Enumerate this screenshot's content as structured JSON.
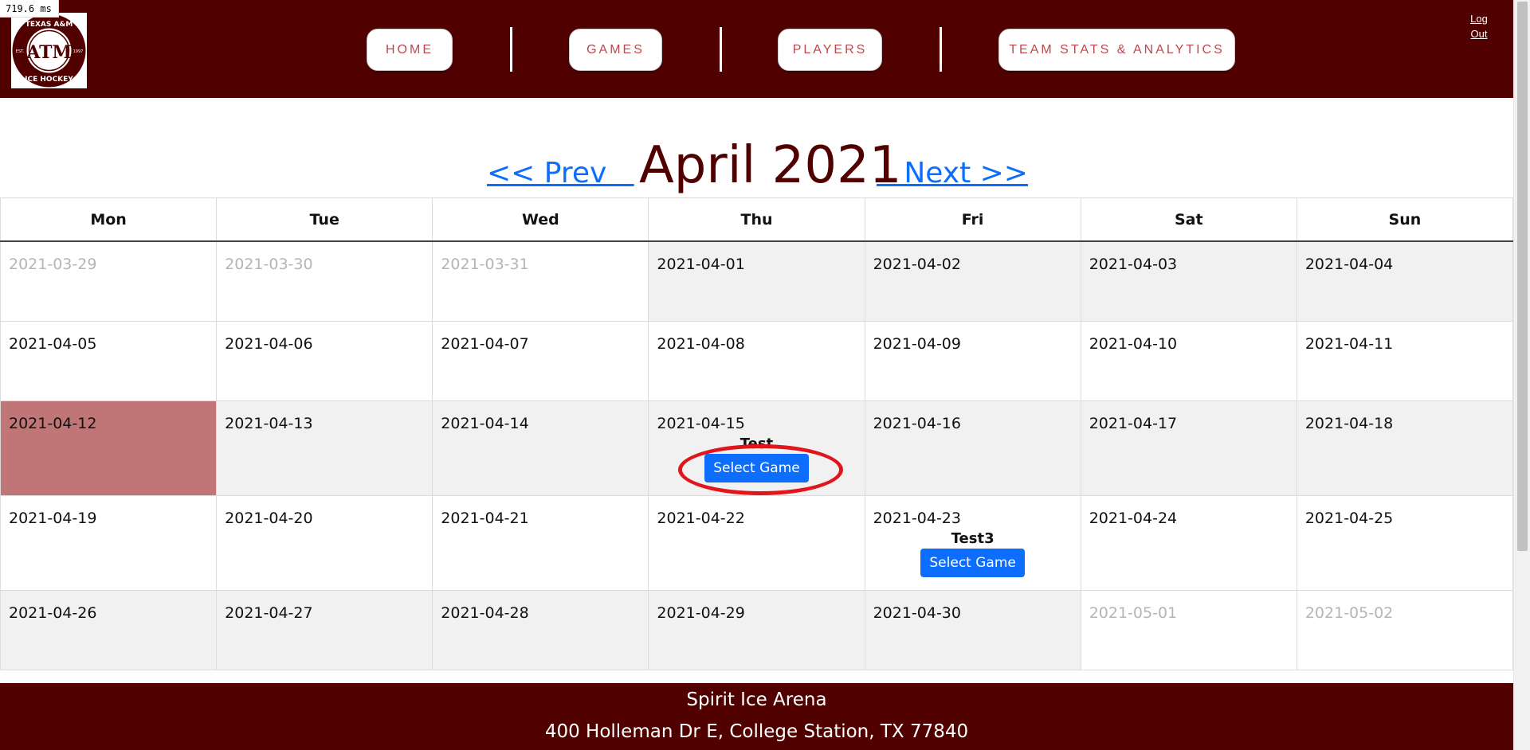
{
  "timer": {
    "text": "719.6 ms"
  },
  "header": {
    "logo": {
      "top_text": "TEXAS A&M",
      "bottom_text": "ICE HOCKEY",
      "est": "EST.",
      "year": "1997",
      "mark": "ATM",
      "icon": "atm-hockey-logo"
    },
    "nav": [
      {
        "label": "HOME"
      },
      {
        "label": "GAMES"
      },
      {
        "label": "PLAYERS"
      },
      {
        "label": "TEAM STATS & ANALYTICS"
      }
    ],
    "logout": {
      "line1": "Log",
      "line2": "Out"
    }
  },
  "month_nav": {
    "prev": "<< Prev   ",
    "title": "April 2021",
    "next": "   Next >>"
  },
  "calendar": {
    "weekdays": [
      "Mon",
      "Tue",
      "Wed",
      "Thu",
      "Fri",
      "Sat",
      "Sun"
    ],
    "weeks": [
      [
        "2021-03-29",
        "2021-03-30",
        "2021-03-31",
        "2021-04-01",
        "2021-04-02",
        "2021-04-03",
        "2021-04-04"
      ],
      [
        "2021-04-05",
        "2021-04-06",
        "2021-04-07",
        "2021-04-08",
        "2021-04-09",
        "2021-04-10",
        "2021-04-11"
      ],
      [
        "2021-04-12",
        "2021-04-13",
        "2021-04-14",
        "2021-04-15",
        "2021-04-16",
        "2021-04-17",
        "2021-04-18"
      ],
      [
        "2021-04-19",
        "2021-04-20",
        "2021-04-21",
        "2021-04-22",
        "2021-04-23",
        "2021-04-24",
        "2021-04-25"
      ],
      [
        "2021-04-26",
        "2021-04-27",
        "2021-04-28",
        "2021-04-29",
        "2021-04-30",
        "2021-05-01",
        "2021-05-02"
      ]
    ],
    "games": [
      {
        "name": "Test",
        "button": "Select Game"
      },
      {
        "name": "Test3",
        "button": "Select Game"
      }
    ]
  },
  "footer": {
    "line1": "Spirit Ice Arena",
    "line2": "400 Holleman Dr E, College Station, TX 77840"
  },
  "colors": {
    "maroon": "#510000",
    "today": "#c07676",
    "button": "#0d6efd",
    "annotation": "#e0161c"
  }
}
